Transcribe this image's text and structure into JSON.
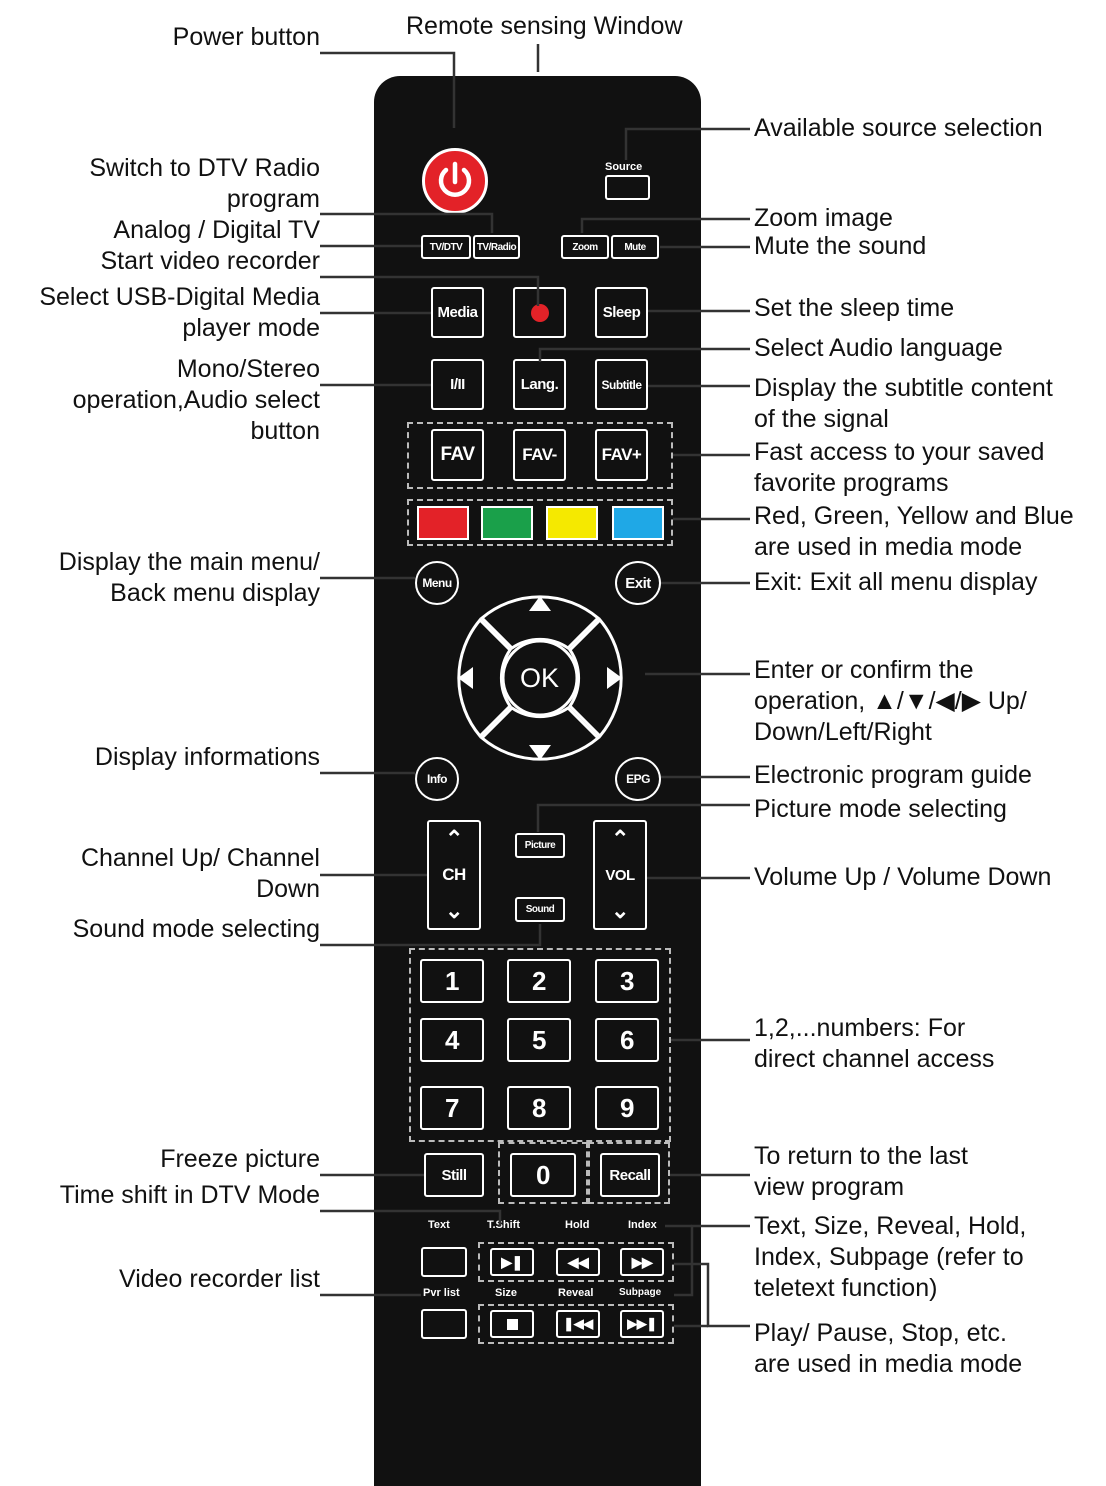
{
  "header": {
    "sensing_window": "Remote sensing Window"
  },
  "left_labels": [
    {
      "id": "power",
      "lines": [
        "Power button"
      ]
    },
    {
      "id": "radio",
      "lines": [
        "Switch to DTV Radio",
        "program"
      ]
    },
    {
      "id": "analog",
      "lines": [
        "Analog / Digital TV"
      ]
    },
    {
      "id": "recorder",
      "lines": [
        "Start video recorder"
      ]
    },
    {
      "id": "usb",
      "lines": [
        "Select USB-Digital Media",
        "player mode"
      ]
    },
    {
      "id": "mono",
      "lines": [
        "Mono/Stereo",
        "operation,Audio select",
        "button"
      ]
    },
    {
      "id": "menu",
      "lines": [
        "Display the main menu/",
        "Back menu display"
      ]
    },
    {
      "id": "info",
      "lines": [
        "Display informations"
      ]
    },
    {
      "id": "channel",
      "lines": [
        "Channel Up/ Channel",
        "Down"
      ]
    },
    {
      "id": "sound",
      "lines": [
        "Sound mode selecting"
      ]
    },
    {
      "id": "freeze",
      "lines": [
        "Freeze picture"
      ]
    },
    {
      "id": "timeshift",
      "lines": [
        "Time shift in DTV Mode"
      ]
    },
    {
      "id": "pvrlist",
      "lines": [
        "Video recorder list"
      ]
    }
  ],
  "right_labels": [
    {
      "id": "source",
      "lines": [
        "Available source selection"
      ]
    },
    {
      "id": "zoom",
      "lines": [
        "Zoom image"
      ]
    },
    {
      "id": "mute",
      "lines": [
        "Mute the sound"
      ]
    },
    {
      "id": "sleep",
      "lines": [
        "Set the sleep time"
      ]
    },
    {
      "id": "lang",
      "lines": [
        "Select Audio language"
      ]
    },
    {
      "id": "subtitle",
      "lines": [
        "Display the subtitle content",
        "of the signal"
      ]
    },
    {
      "id": "fav",
      "lines": [
        "Fast access to your saved",
        "favorite programs"
      ]
    },
    {
      "id": "colors",
      "lines": [
        "Red, Green, Yellow and Blue",
        "are used in media mode"
      ]
    },
    {
      "id": "exit",
      "lines": [
        "Exit: Exit all menu display"
      ]
    },
    {
      "id": "ok",
      "lines": [
        "Enter or confirm the",
        "operation, ▲/▼/◀/▶ Up/",
        "Down/Left/Right"
      ]
    },
    {
      "id": "epg",
      "lines": [
        "Electronic program guide"
      ]
    },
    {
      "id": "picture",
      "lines": [
        "Picture mode selecting"
      ]
    },
    {
      "id": "volume",
      "lines": [
        "Volume Up / Volume Down"
      ]
    },
    {
      "id": "numbers",
      "lines": [
        "1,2,...numbers: For",
        "direct channel access"
      ]
    },
    {
      "id": "recall",
      "lines": [
        "To return to the last",
        "view program"
      ]
    },
    {
      "id": "teletext",
      "lines": [
        "Text, Size, Reveal, Hold,",
        "Index, Subpage (refer to",
        "teletext function)"
      ]
    },
    {
      "id": "media",
      "lines": [
        "Play/ Pause, Stop, etc.",
        "are used in media mode"
      ]
    }
  ],
  "buttons": {
    "source": "Source",
    "tvdtv": "TV/DTV",
    "tvradio": "TV/Radio",
    "zoom": "Zoom",
    "mute": "Mute",
    "media": "Media",
    "sleep": "Sleep",
    "mono": "I/II",
    "lang": "Lang.",
    "subtitle": "Subtitle",
    "fav": "FAV",
    "favminus": "FAV-",
    "favplus": "FAV+",
    "menu": "Menu",
    "exit": "Exit",
    "ok": "OK",
    "info": "Info",
    "epg": "EPG",
    "ch": "CH",
    "picture": "Picture",
    "sound": "Sound",
    "vol": "VOL",
    "digits": [
      "1",
      "2",
      "3",
      "4",
      "5",
      "6",
      "7",
      "8",
      "9"
    ],
    "zero": "0",
    "still": "Still",
    "recall": "Recall",
    "text": "Text",
    "tshift": "T.Shift",
    "hold": "Hold",
    "index": "Index",
    "pvrlist": "Pvr list",
    "size": "Size",
    "reveal": "Reveal",
    "subpage": "Subpage"
  },
  "colors": {
    "red": "#e32228",
    "green": "#1aa04a",
    "yellow": "#f5e900",
    "blue": "#1fa8e6",
    "power": "#e32228"
  }
}
